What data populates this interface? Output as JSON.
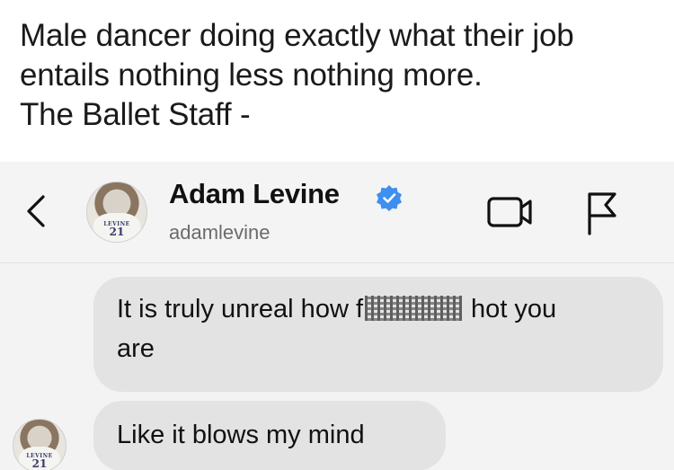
{
  "caption": {
    "line1": "Male dancer doing exactly what their job",
    "line2": "entails nothing less nothing more.",
    "line3": "The Ballet Staff -"
  },
  "header": {
    "name": "Adam Levine",
    "handle": "adamlevine",
    "verified": true,
    "back_icon": "chevron-left-icon",
    "video_icon": "video-camera-icon",
    "flag_icon": "flag-icon",
    "avatar_jersey_name": "LEVINE",
    "avatar_jersey_number": "21"
  },
  "messages": [
    {
      "text_before": "It is truly unreal how f",
      "text_after": " hot you",
      "text_line2": "are",
      "censored": true
    },
    {
      "text": "Like it blows my mind"
    }
  ],
  "colors": {
    "verified": "#3d8ff0",
    "bubble": "#e3e3e3",
    "header_bg": "#f4f4f4"
  }
}
